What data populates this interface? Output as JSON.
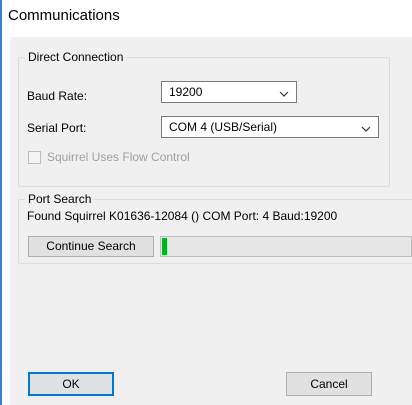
{
  "window": {
    "title": "Communications"
  },
  "direct_connection": {
    "label": "Direct Connection",
    "baud_rate_label": "Baud Rate:",
    "baud_rate_value": "19200",
    "serial_port_label": "Serial Port:",
    "serial_port_value": "COM 4 (USB/Serial)",
    "flow_control_label": "Squirrel Uses Flow Control",
    "flow_control_checked": false
  },
  "port_search": {
    "label": "Port Search",
    "status_text": "Found Squirrel K01636-12084 () COM Port: 4 Baud:19200",
    "continue_button": "Continue Search",
    "progress_fraction": 0.02
  },
  "buttons": {
    "ok": "OK",
    "cancel": "Cancel"
  },
  "colors": {
    "accent": "#0078d7",
    "progress": "#06b025"
  }
}
